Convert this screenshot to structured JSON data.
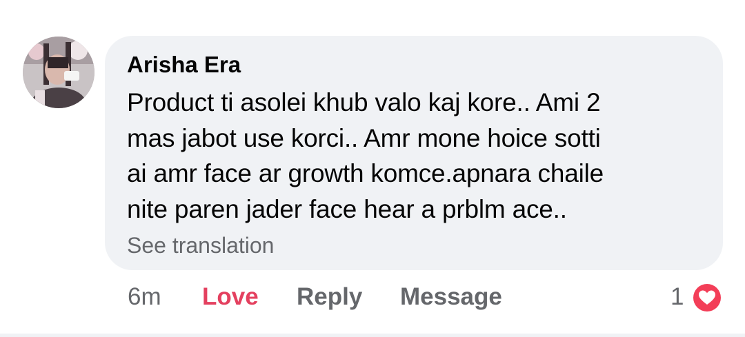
{
  "comment": {
    "author": "Arisha Era",
    "body_lines": [
      "Product ti asolei khub valo kaj kore.. Ami 2",
      "mas jabot use korci.. Amr mone hoice sotti",
      "ai amr face ar growth komce.apnara chaile",
      "nite paren jader face hear a prblm ace.."
    ],
    "see_translation": "See translation",
    "actions": {
      "time": "6m",
      "love": "Love",
      "reply": "Reply",
      "message": "Message"
    },
    "reactions": {
      "count": "1",
      "icon": "love-reaction-icon"
    }
  },
  "colors": {
    "bubble_bg": "#f0f2f5",
    "text": "#050505",
    "secondary": "#65676b",
    "love": "#e4405f",
    "love_icon": "#f33e58"
  }
}
